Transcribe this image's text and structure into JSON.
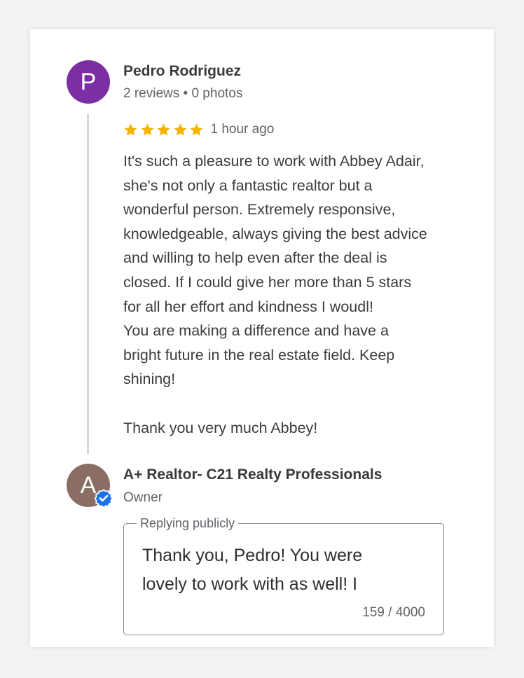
{
  "review": {
    "reviewer_initial": "P",
    "reviewer_name": "Pedro Rodriguez",
    "reviewer_meta": "2 reviews • 0 photos",
    "rating": 5,
    "rating_max": 5,
    "time": "1 hour ago",
    "text_lines": [
      "It's such a pleasure to work with Abbey Adair,",
      "she's not only a fantastic realtor but a",
      "wonderful person. Extremely responsive,",
      "knowledgeable, always giving the best advice",
      "and willing to help even after the deal is",
      "closed. If I could give her more than 5 stars",
      "for all her effort and kindness I woudl!",
      "You are making a difference and have a",
      "bright future in the real estate field. Keep",
      "shining!",
      "",
      "Thank you very much Abbey!"
    ]
  },
  "reply": {
    "owner_initial": "A",
    "owner_name": "A+ Realtor- C21 Realty Professionals",
    "owner_role": "Owner",
    "field_label": "Replying publicly",
    "value_lines": [
      "Thank you, Pedro! You were",
      "lovely to work with as well! I"
    ],
    "char_count": "159 / 4000"
  },
  "colors": {
    "reviewer_avatar": "#7b2fa3",
    "owner_avatar": "#8b6e63",
    "star": "#f4b400",
    "verified_badge": "#1a73e8"
  },
  "icons": {
    "star": "star-icon",
    "verified": "verified-badge-icon"
  }
}
